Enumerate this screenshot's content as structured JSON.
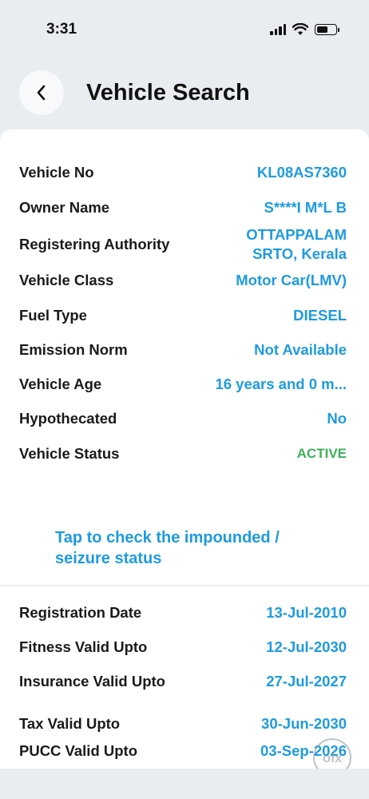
{
  "status_bar": {
    "time": "3:31"
  },
  "header": {
    "title": "Vehicle Search"
  },
  "vehicle_details": [
    {
      "label": "Vehicle No",
      "value": "KL08AS7360"
    },
    {
      "label": "Owner Name",
      "value": "S****I M*L B"
    },
    {
      "label": "Registering Authority",
      "value_line1": "OTTAPPALAM",
      "value_line2": "SRTO, Kerala"
    },
    {
      "label": "Vehicle Class",
      "value": "Motor Car(LMV)"
    },
    {
      "label": "Fuel Type",
      "value": "DIESEL"
    },
    {
      "label": "Emission Norm",
      "value": "Not Available"
    },
    {
      "label": "Vehicle Age",
      "value": "16 years and 0 m..."
    },
    {
      "label": "Hypothecated",
      "value": "No"
    },
    {
      "label": "Vehicle Status",
      "value": "ACTIVE"
    }
  ],
  "impound_link": {
    "line1": "Tap to check the impounded /",
    "line2": "seizure status"
  },
  "validity_details": [
    {
      "label": "Registration Date",
      "value": "13-Jul-2010"
    },
    {
      "label": "Fitness Valid Upto",
      "value": "12-Jul-2030"
    },
    {
      "label": "Insurance Valid Upto",
      "value": "27-Jul-2027"
    },
    {
      "label": "Tax Valid Upto",
      "value": "30-Jun-2030"
    },
    {
      "label": "PUCC Valid Upto",
      "value": "03-Sep-2026"
    }
  ],
  "watermark": {
    "text": "olx"
  },
  "colors": {
    "accent": "#1e9be0",
    "status_active": "#3db25a",
    "background": "#e9edf1"
  }
}
